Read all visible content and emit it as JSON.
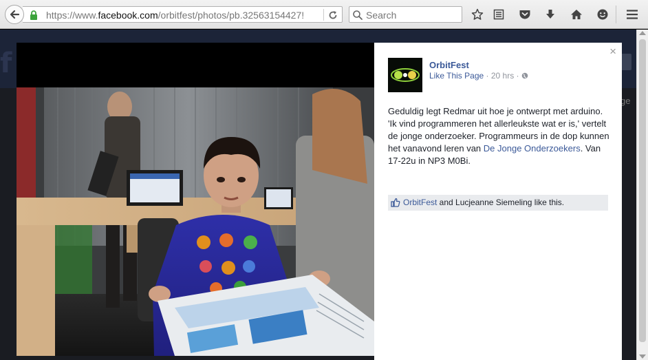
{
  "browser": {
    "url_prefix": "https://www.",
    "url_host": "facebook.com",
    "url_path": "/orbitfest/photos/pb.32563154427!",
    "search_placeholder": "Search"
  },
  "page_background": {
    "logo_letter": "f",
    "side_text": "ge"
  },
  "post": {
    "page_name": "OrbitFest",
    "like_link": "Like This Page",
    "meta_sep": " · ",
    "timestamp": "20 hrs",
    "meta_sep2": " · ",
    "text_main": "Geduldig legt Redmar uit hoe je ontwerpt met arduino. 'Ik vind programmeren het allerleukste wat er is,' vertelt de jonge onderzoeker. Programmeurs in de dop kunnen het vanavond leren van ",
    "mention": "De Jonge Onderzoekers",
    "text_tail": ". Van 17-22u in NP3 M0Bi.",
    "likes_first": "OrbitFest",
    "likes_rest": " and Lucjeanne Siemeling like this.",
    "close_symbol": "×"
  },
  "colors": {
    "link": "#3b5998",
    "toolbar_icon": "#444444"
  }
}
